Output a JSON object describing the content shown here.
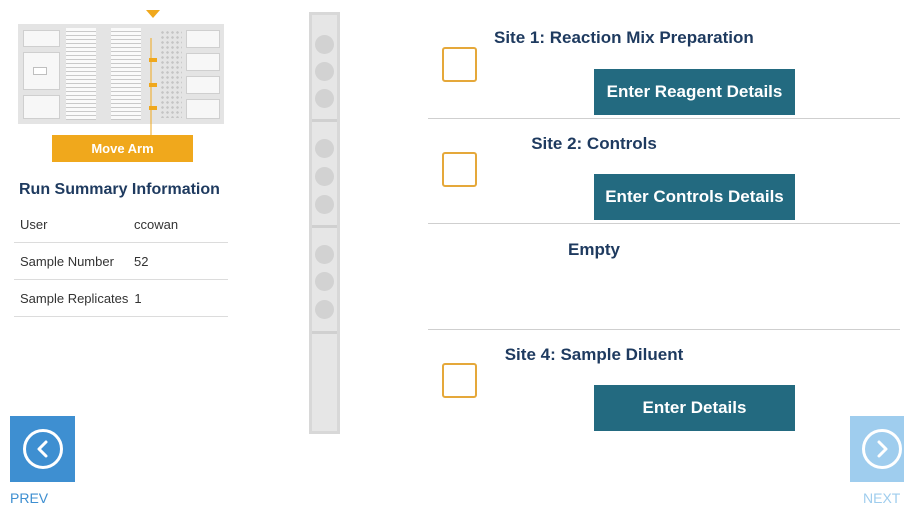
{
  "deck": {
    "move_arm_label": "Move Arm",
    "accent_color": "#f0a81c"
  },
  "run_summary": {
    "title": "Run Summary Information",
    "rows": [
      {
        "label": "User",
        "value": "ccowan"
      },
      {
        "label": "Sample Number",
        "value": "52"
      },
      {
        "label": "Sample Replicates",
        "value": "1"
      }
    ]
  },
  "sites": [
    {
      "title": "Site 1: Reaction Mix Preparation",
      "button": "Enter Reagent Details",
      "checked": false
    },
    {
      "title": "Site 2: Controls",
      "button": "Enter Controls Details",
      "checked": false
    },
    {
      "title": "Empty"
    },
    {
      "title": "Site 4: Sample Diluent",
      "button": "Enter Details",
      "checked": false
    }
  ],
  "nav": {
    "prev_label": "PREV",
    "next_label": "NEXT",
    "prev_color": "#3e8fd1",
    "next_color": "#9fcdee"
  },
  "colors": {
    "heading": "#1e3a5f",
    "button": "#236a80",
    "checkbox_border": "#e5a83a"
  }
}
